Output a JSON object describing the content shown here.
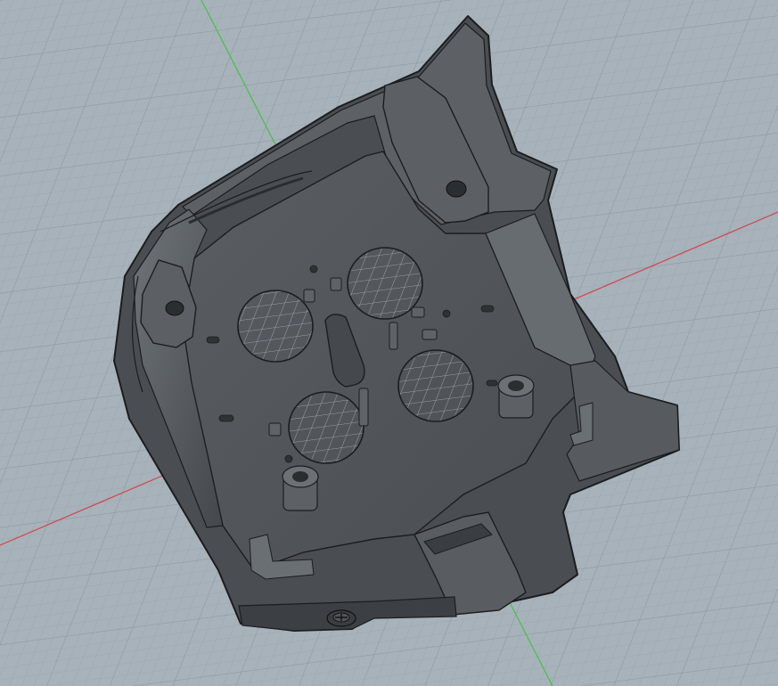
{
  "scene": {
    "description_kind": "cad-viewport",
    "colors": {
      "background": "#a7b2ba",
      "grid_minor": "#9aa6ae",
      "grid_major": "#8c98a1",
      "axis_green": "#46c146",
      "axis_red": "#d4434a",
      "part_dark": "#3d4145",
      "part_mid": "#55595e",
      "part_light": "#6b7075",
      "part_face": "#4e5257",
      "edge": "#1b1d1f"
    },
    "icons": [
      "screw-head-icon"
    ]
  }
}
